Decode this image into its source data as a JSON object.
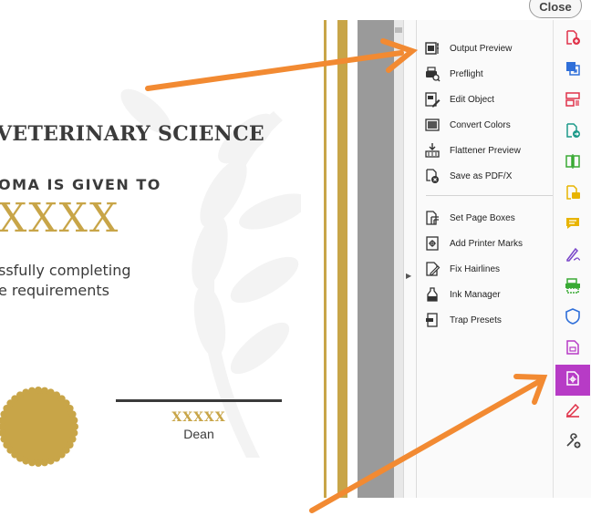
{
  "window": {
    "close_label": "Close"
  },
  "certificate": {
    "title": "VETERINARY SCIENCE",
    "given_to": "OMA IS GIVEN TO",
    "recipient": "XXXX",
    "body_line1": "ssfully completing",
    "body_line2": "e requirements",
    "signer_name": "XXXXX",
    "signer_role": "Dean",
    "gold_color": "#c8a548"
  },
  "tools_panel": {
    "items": [
      {
        "label": "Output Preview",
        "icon": "output-preview-icon"
      },
      {
        "label": "Preflight",
        "icon": "preflight-icon"
      },
      {
        "label": "Edit Object",
        "icon": "edit-object-icon"
      },
      {
        "label": "Convert Colors",
        "icon": "convert-colors-icon"
      },
      {
        "label": "Flattener Preview",
        "icon": "flattener-preview-icon"
      },
      {
        "label": "Save as PDF/X",
        "icon": "save-as-pdfx-icon"
      },
      {
        "label": "Set Page Boxes",
        "icon": "set-page-boxes-icon"
      },
      {
        "label": "Add Printer Marks",
        "icon": "add-printer-marks-icon"
      },
      {
        "label": "Fix Hairlines",
        "icon": "fix-hairlines-icon"
      },
      {
        "label": "Ink Manager",
        "icon": "ink-manager-icon"
      },
      {
        "label": "Trap Presets",
        "icon": "trap-presets-icon"
      }
    ]
  },
  "right_rail": {
    "tools": [
      {
        "icon": "create-pdf-icon",
        "color": "#e0334a"
      },
      {
        "icon": "export-pdf-icon",
        "color": "#2f6fd9"
      },
      {
        "icon": "organize-pages-icon",
        "color": "#e0334a"
      },
      {
        "icon": "send-for-review-icon",
        "color": "#1d9a8a"
      },
      {
        "icon": "compare-files-icon",
        "color": "#3aaa35"
      },
      {
        "icon": "share-icon",
        "color": "#e8b400"
      },
      {
        "icon": "comment-icon",
        "color": "#e8b400"
      },
      {
        "icon": "fill-sign-icon",
        "color": "#7a47c9"
      },
      {
        "icon": "scan-ocr-icon",
        "color": "#3aaa35"
      },
      {
        "icon": "protect-icon",
        "color": "#2f6fd9"
      },
      {
        "icon": "accessibility-icon",
        "color": "#b73bc6"
      },
      {
        "icon": "print-production-icon",
        "color": "#b73bc6",
        "active": true
      },
      {
        "icon": "redact-icon",
        "color": "#e0334a"
      },
      {
        "icon": "more-tools-icon",
        "color": "#444444"
      }
    ]
  },
  "annotation": {
    "arrow_color": "#f28a32"
  }
}
